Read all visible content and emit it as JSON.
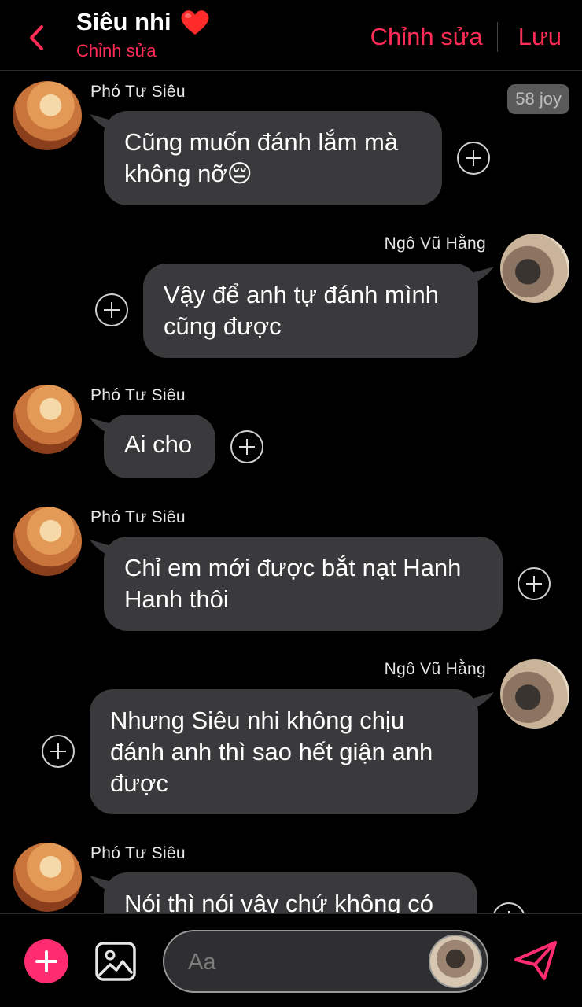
{
  "header": {
    "title": "Siêu nhi",
    "title_icon": "heart-icon",
    "subtitle": "Chỉnh sửa",
    "edit_label": "Chỉnh sửa",
    "save_label": "Lưu",
    "accent": "#ff2d55"
  },
  "joy_badge": "58 joy",
  "messages": [
    {
      "sender": "Phó Tư Siêu",
      "lines": [
        "Cũng muốn đánh lắm mà",
        "không nỡ😔"
      ],
      "side": "left"
    },
    {
      "sender": "Ngô Vũ Hằng",
      "lines": [
        "Vậy để anh tự đánh mình",
        "cũng được"
      ],
      "side": "right"
    },
    {
      "sender": "Phó Tư Siêu",
      "lines": [
        "Ai cho"
      ],
      "side": "left"
    },
    {
      "sender": "Phó Tư Siêu",
      "lines": [
        "Chỉ em mới được bắt nạt Hanh",
        "Hanh thôi"
      ],
      "side": "left"
    },
    {
      "sender": "Ngô Vũ Hằng",
      "lines": [
        "Nhưng Siêu nhi không chịu",
        "đánh anh thì sao hết giận anh",
        "được"
      ],
      "side": "right"
    },
    {
      "sender": "Phó Tư Siêu",
      "lines": [
        "Nói thì nói vậy chứ không có"
      ],
      "side": "left"
    }
  ],
  "composer": {
    "placeholder": "Aa",
    "add_icon": "plus-icon",
    "image_icon": "image-icon",
    "send_icon": "send-icon"
  },
  "colors": {
    "background": "#000000",
    "bubble": "#3a3a3c",
    "add_button": "#ff2d6f"
  }
}
